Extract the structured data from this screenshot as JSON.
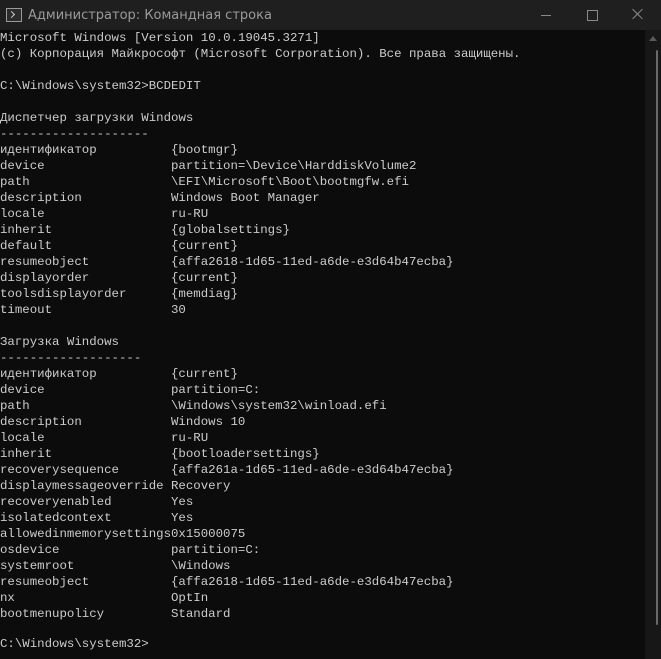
{
  "window": {
    "title": "Администратор: Командная строка"
  },
  "console": {
    "header": [
      "Microsoft Windows [Version 10.0.19045.3271]",
      "(c) Корпорация Майкрософт (Microsoft Corporation). Все права защищены."
    ],
    "command_prompt": "C:\\Windows\\system32>BCDEDIT",
    "final_prompt": "C:\\Windows\\system32>",
    "sections": [
      {
        "title": "Диспетчер загрузки Windows",
        "underline": "--------------------",
        "entries": [
          {
            "key": "идентификатор",
            "value": "{bootmgr}"
          },
          {
            "key": "device",
            "value": "partition=\\Device\\HarddiskVolume2"
          },
          {
            "key": "path",
            "value": "\\EFI\\Microsoft\\Boot\\bootmgfw.efi"
          },
          {
            "key": "description",
            "value": "Windows Boot Manager"
          },
          {
            "key": "locale",
            "value": "ru-RU"
          },
          {
            "key": "inherit",
            "value": "{globalsettings}"
          },
          {
            "key": "default",
            "value": "{current}"
          },
          {
            "key": "resumeobject",
            "value": "{affa2618-1d65-11ed-a6de-e3d64b47ecba}"
          },
          {
            "key": "displayorder",
            "value": "{current}"
          },
          {
            "key": "toolsdisplayorder",
            "value": "{memdiag}"
          },
          {
            "key": "timeout",
            "value": "30"
          }
        ]
      },
      {
        "title": "Загрузка Windows",
        "underline": "-------------------",
        "entries": [
          {
            "key": "идентификатор",
            "value": "{current}"
          },
          {
            "key": "device",
            "value": "partition=C:"
          },
          {
            "key": "path",
            "value": "\\Windows\\system32\\winload.efi"
          },
          {
            "key": "description",
            "value": "Windows 10"
          },
          {
            "key": "locale",
            "value": "ru-RU"
          },
          {
            "key": "inherit",
            "value": "{bootloadersettings}"
          },
          {
            "key": "recoverysequence",
            "value": "{affa261a-1d65-11ed-a6de-e3d64b47ecba}"
          },
          {
            "key": "displaymessageoverride",
            "value": "Recovery"
          },
          {
            "key": "recoveryenabled",
            "value": "Yes"
          },
          {
            "key": "isolatedcontext",
            "value": "Yes"
          },
          {
            "key": "allowedinmemorysettings",
            "value": "0x15000075"
          },
          {
            "key": "osdevice",
            "value": "partition=C:"
          },
          {
            "key": "systemroot",
            "value": "\\Windows"
          },
          {
            "key": "resumeobject",
            "value": "{affa2618-1d65-11ed-a6de-e3d64b47ecba}"
          },
          {
            "key": "nx",
            "value": "OptIn"
          },
          {
            "key": "bootmenupolicy",
            "value": "Standard"
          }
        ]
      }
    ]
  }
}
